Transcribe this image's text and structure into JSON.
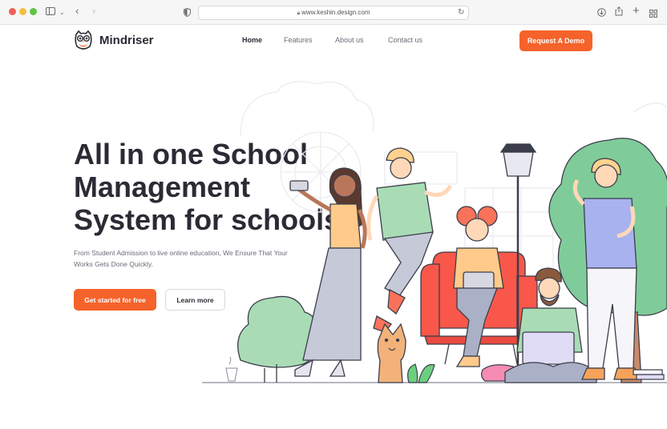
{
  "browser": {
    "url": "www.keshin.design.com",
    "icons": [
      "close-dot",
      "minimize-dot",
      "zoom-dot",
      "sidebar-icon",
      "chevron-down-icon",
      "back-icon",
      "forward-icon",
      "shield-icon",
      "lock-icon",
      "reload-icon",
      "download-icon",
      "share-icon",
      "new-tab-icon",
      "tab-overview-icon"
    ],
    "colors": {
      "close": "#ee5f57",
      "minimize": "#f5be3c",
      "zoom": "#5fc443"
    }
  },
  "nav": {
    "brand": "Mindriser",
    "logo_icon": "owl-icon",
    "links": [
      "Home",
      "Features",
      "About us",
      "Contact us"
    ],
    "active": "Home",
    "cta": "Request A Demo"
  },
  "hero": {
    "headline": [
      "All in one School",
      "Management",
      "System for schools"
    ],
    "subtext": "From Student Admission to live online education, We Ensure That Your Works Gets Done Quickly.",
    "primary_button": "Get started for free",
    "secondary_button": "Learn more",
    "illustration": "people-in-park-illustration"
  },
  "colors": {
    "accent": "#f5632b",
    "heading": "#2b2b35",
    "muted": "#6b6b78"
  }
}
